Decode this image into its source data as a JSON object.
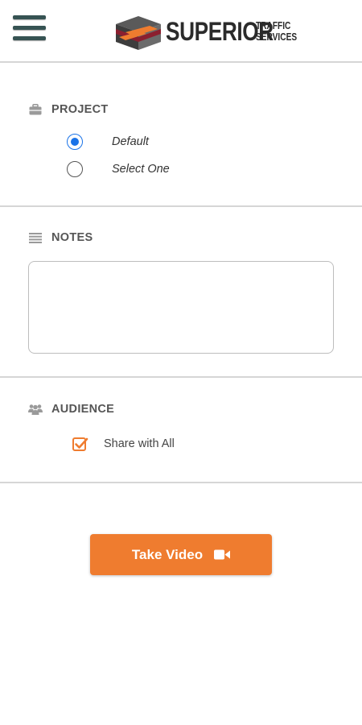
{
  "header": {
    "brand_word": "SUPERIOR",
    "brand_sub_1": "TRAFFIC",
    "brand_sub_2": "SERVICES"
  },
  "project": {
    "label": "PROJECT",
    "options": [
      {
        "label": "Default",
        "selected": true
      },
      {
        "label": "Select One",
        "selected": false
      }
    ]
  },
  "notes": {
    "label": "NOTES",
    "value": "",
    "placeholder": ""
  },
  "audience": {
    "label": "AUDIENCE",
    "share_label": "Share with All",
    "share_checked": true
  },
  "action": {
    "take_video_label": "Take Video"
  },
  "colors": {
    "accent_orange": "#ef7c2f",
    "radio_blue": "#1a73e8",
    "menu_teal": "#365353",
    "brand_red": "#8b1f2f"
  },
  "icons": {
    "menu": "hamburger-menu-icon",
    "project": "briefcase-icon",
    "notes": "lines-icon",
    "audience": "people-group-icon",
    "video": "video-camera-icon"
  }
}
